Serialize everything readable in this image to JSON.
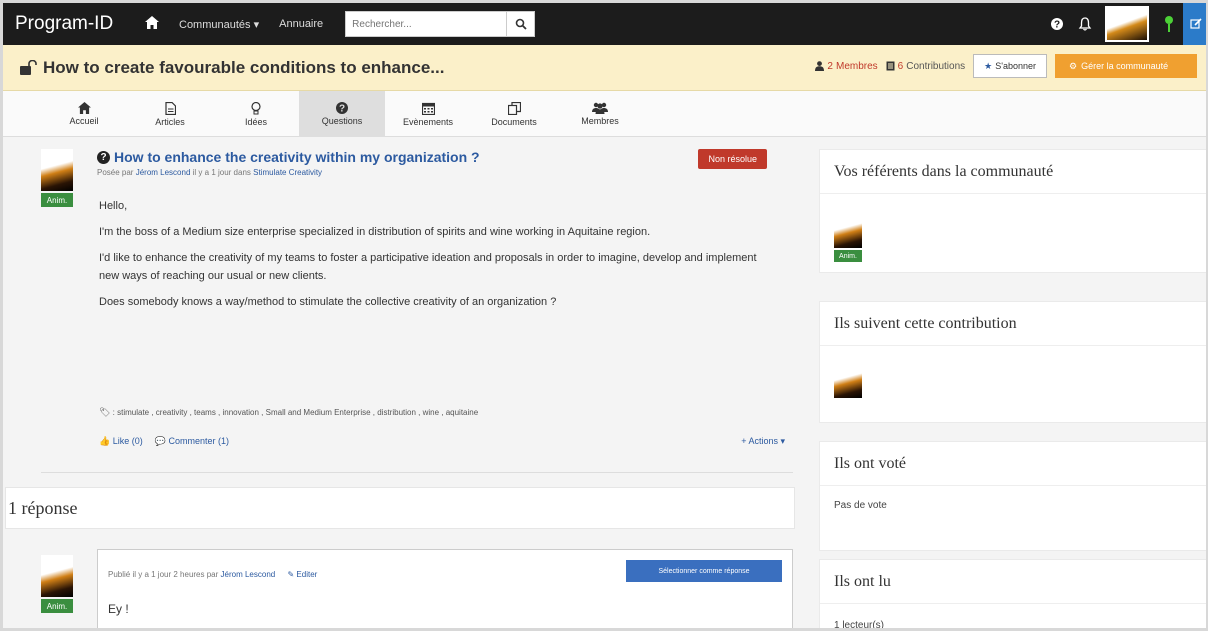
{
  "topbar": {
    "brand": "Program-ID",
    "nav": [
      "Communautés ▾",
      "Annuaire"
    ],
    "search_placeholder": "Rechercher..."
  },
  "community": {
    "title": "How to create favourable conditions to enhance...",
    "members_count": "2",
    "members_label": "Membres",
    "contributions_count": "6",
    "contributions_label": "Contributions",
    "subscribe_label": "S'abonner",
    "manage_label": "Gérer la communauté"
  },
  "tabs": [
    {
      "label": "Accueil",
      "icon": "home-icon"
    },
    {
      "label": "Articles",
      "icon": "file-icon"
    },
    {
      "label": "Idées",
      "icon": "lightbulb-icon"
    },
    {
      "label": "Questions",
      "icon": "question-icon"
    },
    {
      "label": "Evènements",
      "icon": "calendar-icon"
    },
    {
      "label": "Documents",
      "icon": "copy-icon"
    },
    {
      "label": "Membres",
      "icon": "users-icon"
    }
  ],
  "active_tab": "Questions",
  "question": {
    "title": "How to enhance the creativity within my organization ?",
    "meta_prefix": "Posée par",
    "author": "Jérom Lescond",
    "meta_middle": "il y a 1 jour dans",
    "category": "Stimulate Creativity",
    "status": "Non résolue",
    "badge": "Anim.",
    "paragraphs": [
      "Hello,",
      "I'm the boss of a Medium size enterprise specialized in distribution of spirits and wine working in Aquitaine region.",
      "I'd like to enhance the creativity of my teams to foster a participative ideation and proposals in order to imagine, develop and implement new ways of reaching our usual or new clients.",
      "Does somebody knows a way/method to stimulate the collective creativity of an organization ?"
    ],
    "tags_text": ": stimulate , creativity , teams , innovation , Small and Medium Enterprise , distribution , wine , aquitaine",
    "like_label": "Like (0)",
    "comment_label": "Commenter (1)",
    "actions_label": "+ Actions ▾"
  },
  "answers": {
    "heading": "1 réponse",
    "item": {
      "meta_prefix": "Publié il y a 1 jour 2 heures par",
      "author": "Jérom Lescond",
      "edit_label": "Editer",
      "button_label": "Sélectionner comme réponse",
      "badge": "Anim.",
      "text": "Ey !"
    }
  },
  "sidebar": {
    "referents_title": "Vos référents dans la communauté",
    "referents_badge": "Anim.",
    "followers_title": "Ils suivent cette contribution",
    "voted_title": "Ils ont voté",
    "voted_text": "Pas de vote",
    "read_title": "Ils ont lu",
    "read_text": "1 lecteur(s)"
  }
}
